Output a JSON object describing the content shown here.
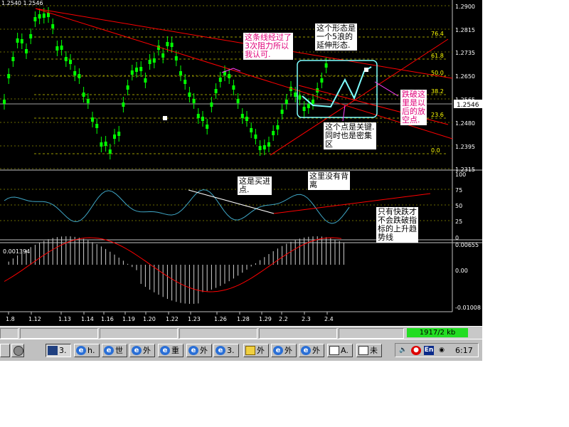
{
  "chart": {
    "header_text": "1.2540 1.2546",
    "price_labels": [
      "1.2900",
      "1.2815",
      "1.2735",
      "1.2650",
      "1.2565",
      "1.2480",
      "1.2395",
      "1.2315"
    ],
    "current_price": "1.2546",
    "fib_levels": [
      "76.4",
      "61.8",
      "50.0",
      "38.2",
      "23.6",
      "0.0"
    ],
    "rsi_labels": [
      "100",
      "75",
      "50",
      "25",
      "0"
    ],
    "macd_labels": [
      "0.00655",
      "0.00",
      "-0.01008"
    ],
    "macd_header": "0.001394",
    "date_labels": [
      "1.8",
      "1.12",
      "1.13",
      "1.14",
      "1.16",
      "1.19",
      "1.20",
      "1.22",
      "1.23",
      "1.26",
      "1.28",
      "1.29",
      "2.2",
      "2.3",
      "2.4"
    ],
    "colors": {
      "candles": "#00ff00",
      "trendline": "#ff0000",
      "grid": "#6a6a00",
      "fib": "#cccc00",
      "rsi": "#3fa7c7",
      "macd_signal": "#ff0000"
    }
  },
  "annotations": {
    "resistance": "这条线经过了\n3次阻力所以\n我认可.",
    "wave5": "这个形态是\n一个5浪的\n延伸形态.",
    "breakdown": "跌破这\n里是以\n后的放\n空点.",
    "keypoint": "这个点是关键.\n同时也是密集\n区",
    "buy": "这是买进\n点.",
    "no_divergence": "这里没有背\n离",
    "trend_note": "只有快跌才\n不会跌破指\n标的上升趋\n势线"
  },
  "status": {
    "file_size": "1917/2 kb"
  },
  "taskbar": {
    "items": [
      {
        "label": "3.",
        "icon": "app-icon",
        "pressed": true
      },
      {
        "label": "h.",
        "icon": "ie-icon"
      },
      {
        "label": "世",
        "icon": "ie-icon"
      },
      {
        "label": "外",
        "icon": "ie-icon"
      },
      {
        "label": "重",
        "icon": "ie-icon"
      },
      {
        "label": "外",
        "icon": "ie-icon"
      },
      {
        "label": "3.",
        "icon": "ie-icon"
      },
      {
        "label": "外",
        "icon": "folder-icon"
      },
      {
        "label": "外",
        "icon": "ie-icon"
      },
      {
        "label": "外",
        "icon": "ie-icon"
      },
      {
        "label": "A.",
        "icon": "doc-icon"
      },
      {
        "label": "未",
        "icon": "doc-icon"
      }
    ],
    "tray_lang": "En",
    "clock": "6:17"
  }
}
